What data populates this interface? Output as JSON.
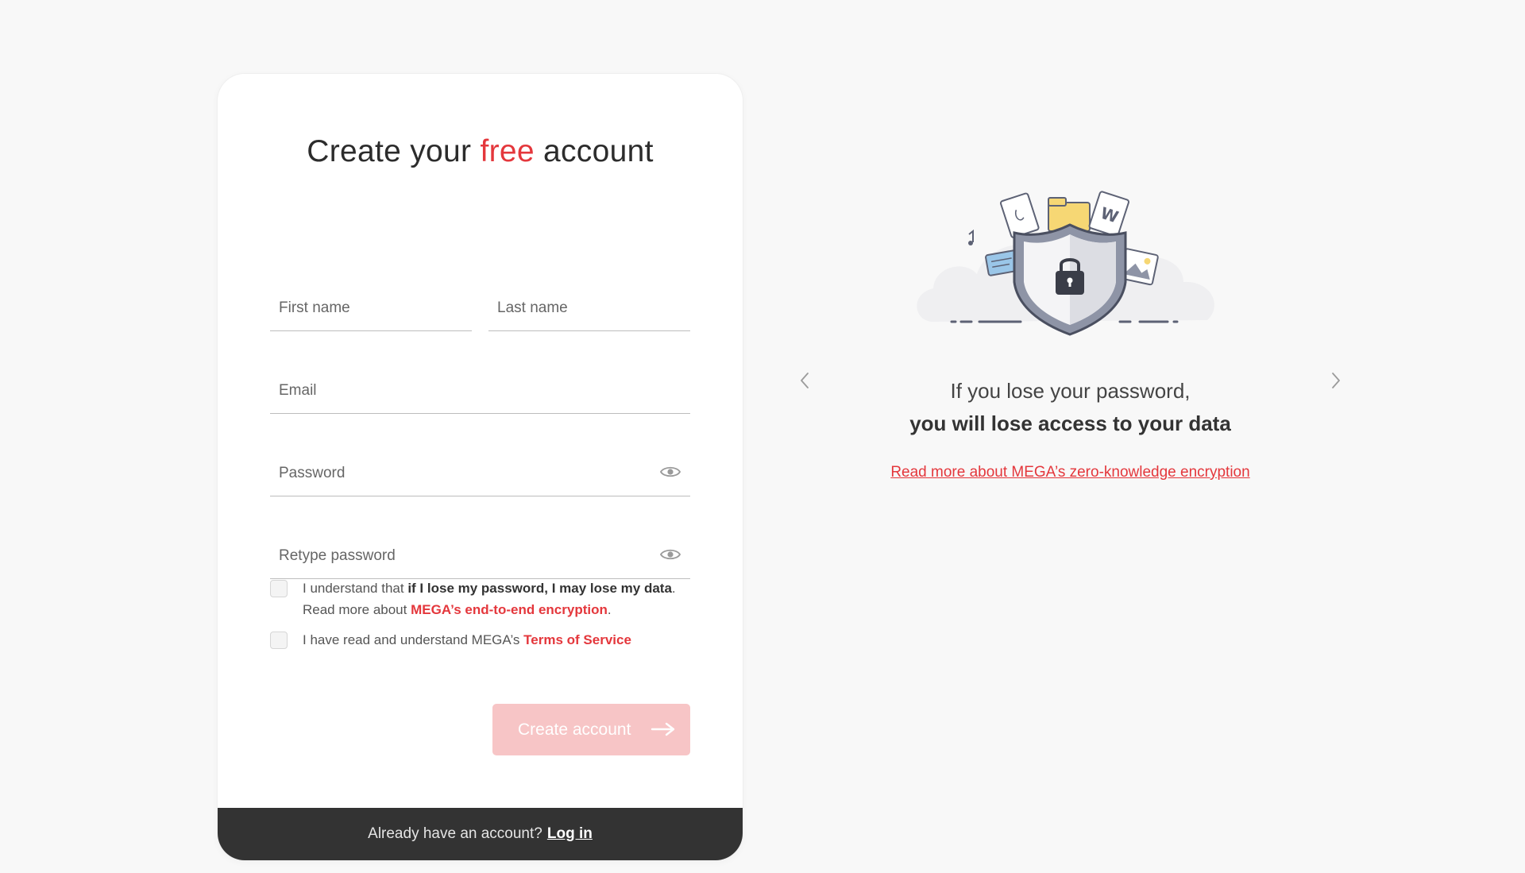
{
  "form": {
    "title_part1": "Create your ",
    "title_accent": "free",
    "title_part2": " account",
    "first_name_placeholder": "First name",
    "last_name_placeholder": "Last name",
    "email_placeholder": "Email",
    "password_placeholder": "Password",
    "retype_password_placeholder": "Retype password",
    "checkbox1": {
      "text_a": "I understand that ",
      "bold": "if I lose my password, I may lose my data",
      "text_b": ". Read more about ",
      "link": "MEGA’s end-to-end encryption",
      "text_c": ".",
      "checked": false
    },
    "checkbox2": {
      "text_a": "I have read and understand MEGA’s ",
      "link": "Terms of Service",
      "checked": false
    },
    "create_button_label": "Create account",
    "footer_text": "Already have an account?",
    "login_link": "Log in"
  },
  "carousel": {
    "line1": "If you lose your password,",
    "line2": "you will lose access to your data",
    "link": "Read more about MEGA’s zero-knowledge encryption"
  },
  "colors": {
    "accent": "#e4373c",
    "button_disabled": "#f7c5c6",
    "footer_bg": "#333333"
  },
  "icons": [
    "eye-icon",
    "arrow-right-icon",
    "chevron-left-icon",
    "chevron-right-icon",
    "shield-lock-icon"
  ]
}
